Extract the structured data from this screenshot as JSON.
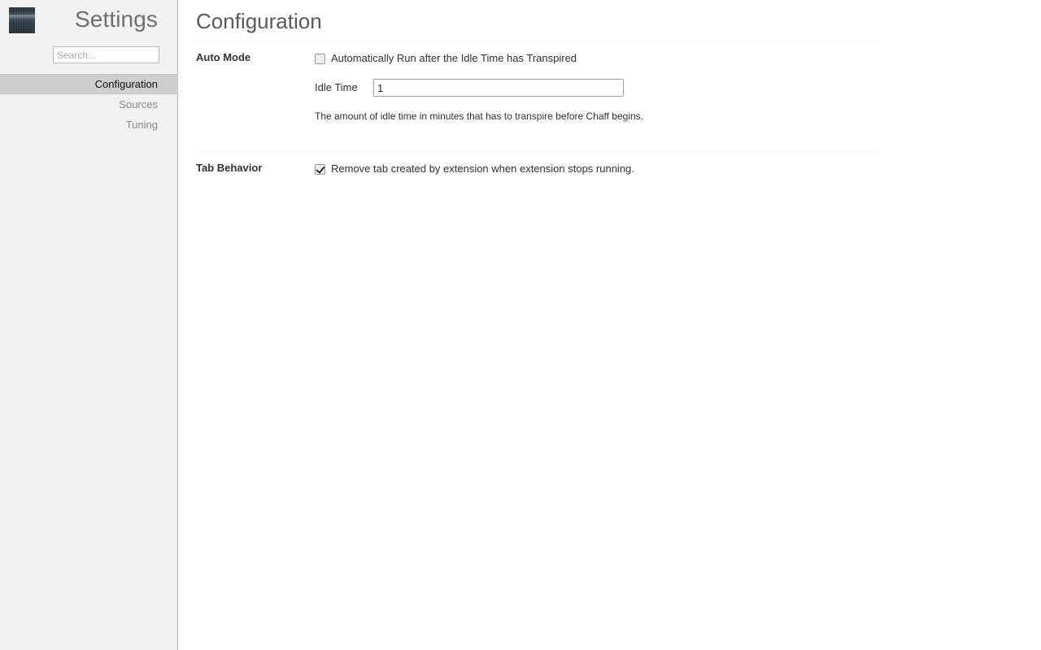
{
  "sidebar": {
    "logo_icon": "extension-logo-icon",
    "title": "Settings",
    "search": {
      "placeholder": "Search...",
      "value": ""
    },
    "items": [
      {
        "label": "Configuration",
        "selected": true
      },
      {
        "label": "Sources",
        "selected": false
      },
      {
        "label": "Tuning",
        "selected": false
      }
    ]
  },
  "content": {
    "page_title": "Configuration",
    "sections": [
      {
        "label": "Auto Mode",
        "checkbox_label": "Automatically Run after the Idle Time has Transpired",
        "checkbox_checked": false,
        "idle_label": "Idle Time",
        "idle_value": "1",
        "help_text": "The amount of idle time in minutes that has to transpire before Chaff begins."
      },
      {
        "label": "Tab Behavior",
        "checkbox_label": "Remove tab created by extension when extension stops running.",
        "checkbox_checked": true
      }
    ]
  },
  "colors": {
    "sidebar_bg": "#f2f2f2",
    "sidebar_border": "#b5b5b5",
    "selected_bg": "#cecece",
    "title_gray": "#6f6f6f",
    "divider": "#eeeeee",
    "text_dark": "#333333",
    "text_muted": "#8a8a8a"
  }
}
